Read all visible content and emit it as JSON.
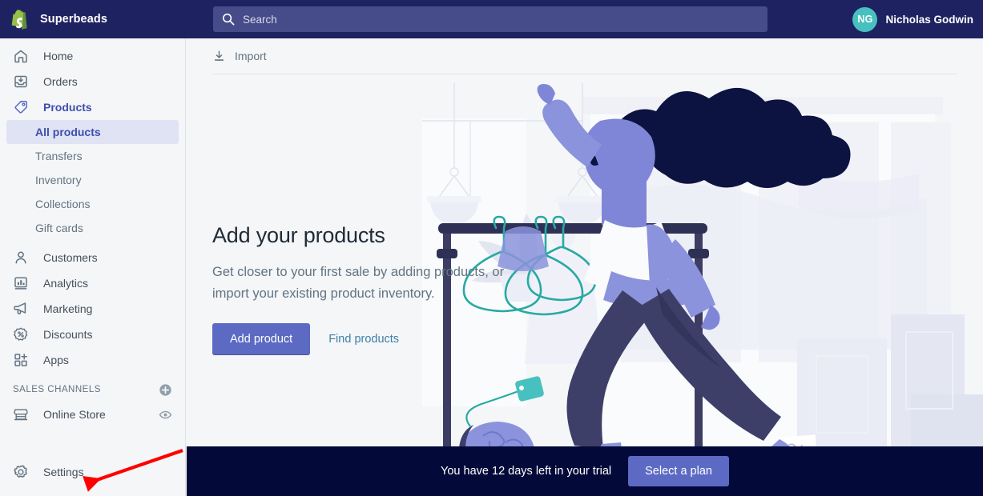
{
  "topbar": {
    "logo_icon": "shopify-bag-logo",
    "store_name": "Superbeads",
    "search": {
      "icon": "search-icon",
      "placeholder": "Search",
      "value": ""
    },
    "user": {
      "initials": "NG",
      "name": "Nicholas Godwin",
      "avatar_color": "#47c1bf"
    }
  },
  "sidebar": {
    "items": [
      {
        "label": "Home",
        "icon": "home-icon"
      },
      {
        "label": "Orders",
        "icon": "orders-inbox-icon"
      },
      {
        "label": "Products",
        "icon": "products-tag-icon",
        "active": true
      }
    ],
    "product_subitems": [
      {
        "label": "All products",
        "active": true
      },
      {
        "label": "Transfers",
        "active": false
      },
      {
        "label": "Inventory",
        "active": false
      },
      {
        "label": "Collections",
        "active": false
      },
      {
        "label": "Gift cards",
        "active": false
      }
    ],
    "items2": [
      {
        "label": "Customers",
        "icon": "customer-person-icon"
      },
      {
        "label": "Analytics",
        "icon": "analytics-bars-icon"
      },
      {
        "label": "Marketing",
        "icon": "marketing-megaphone-icon"
      },
      {
        "label": "Discounts",
        "icon": "discounts-percent-icon"
      },
      {
        "label": "Apps",
        "icon": "apps-grid-plus-icon"
      }
    ],
    "sales_channels": {
      "title": "SALES CHANNELS",
      "add_icon": "circle-plus-icon",
      "channels": [
        {
          "label": "Online Store",
          "icon": "online-store-icon",
          "trailing_icon": "eye-icon"
        }
      ]
    },
    "settings": {
      "label": "Settings",
      "icon": "gear-icon"
    }
  },
  "main": {
    "import": {
      "label": "Import",
      "icon": "import-download-icon"
    },
    "empty_state": {
      "headline": "Add your products",
      "description": "Get closer to your first sale by adding products, or import your existing product inventory.",
      "primary_button": "Add product",
      "secondary_link": "Find products",
      "illustration": "woman-with-clothing-rack-illustration"
    }
  },
  "trial_banner": {
    "message": "You have 12 days left in your trial",
    "button": "Select a plan",
    "background": "#030a39"
  },
  "annotation": {
    "arrow": "red-arrow-pointing-to-settings",
    "color": "#ff0000"
  },
  "colors": {
    "topbar": "#1f2260",
    "accent_purple": "#5c6ac4",
    "active_nav_bg": "#dfe3f3",
    "active_nav_text": "#3f4eae",
    "page_bg": "#f4f6f8",
    "link_blue": "#3f7ea6"
  }
}
